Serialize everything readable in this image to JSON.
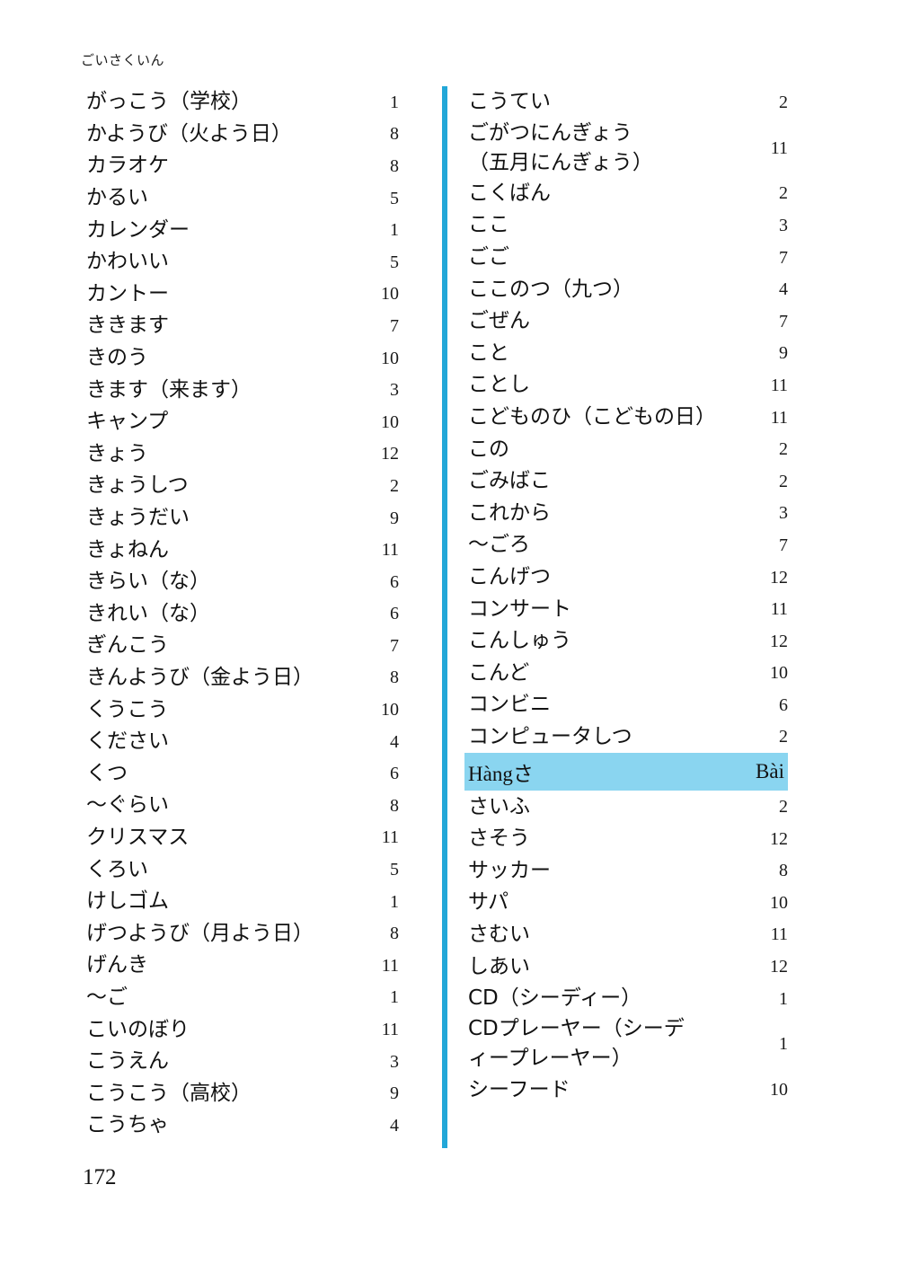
{
  "page": {
    "running_head": "ごいさくいん",
    "folio": "172",
    "accent_color": "#22a7d8",
    "highlight_color": "#8ad5f0"
  },
  "left_column": {
    "entries": [
      {
        "term": "がっこう（学校）",
        "lesson": "1"
      },
      {
        "term": "かようび（火よう日）",
        "lesson": "8"
      },
      {
        "term": "カラオケ",
        "lesson": "8"
      },
      {
        "term": "かるい",
        "lesson": "5"
      },
      {
        "term": "カレンダー",
        "lesson": "1"
      },
      {
        "term": "かわいい",
        "lesson": "5"
      },
      {
        "term": "カントー",
        "lesson": "10"
      },
      {
        "term": "ききます",
        "lesson": "7"
      },
      {
        "term": "きのう",
        "lesson": "10"
      },
      {
        "term": "きます（来ます）",
        "lesson": "3"
      },
      {
        "term": "キャンプ",
        "lesson": "10"
      },
      {
        "term": "きょう",
        "lesson": "12"
      },
      {
        "term": "きょうしつ",
        "lesson": "2"
      },
      {
        "term": "きょうだい",
        "lesson": "9"
      },
      {
        "term": "きょねん",
        "lesson": "11"
      },
      {
        "term": "きらい（な）",
        "lesson": "6"
      },
      {
        "term": "きれい（な）",
        "lesson": "6"
      },
      {
        "term": "ぎんこう",
        "lesson": "7"
      },
      {
        "term": "きんようび（金よう日）",
        "lesson": "8"
      },
      {
        "term": "くうこう",
        "lesson": "10"
      },
      {
        "term": "ください",
        "lesson": "4"
      },
      {
        "term": "くつ",
        "lesson": "6"
      },
      {
        "term": "〜ぐらい",
        "lesson": "8"
      },
      {
        "term": "クリスマス",
        "lesson": "11"
      },
      {
        "term": "くろい",
        "lesson": "5"
      },
      {
        "term": "けしゴム",
        "lesson": "1"
      },
      {
        "term": "げつようび（月よう日）",
        "lesson": "8"
      },
      {
        "term": "げんき",
        "lesson": "11"
      },
      {
        "term": "〜ご",
        "lesson": "1"
      },
      {
        "term": "こいのぼり",
        "lesson": "11"
      },
      {
        "term": "こうえん",
        "lesson": "3"
      },
      {
        "term": "こうこう（高校）",
        "lesson": "9"
      },
      {
        "term": "こうちゃ",
        "lesson": "4"
      }
    ]
  },
  "right_column": {
    "entries_before_section": [
      {
        "term": "こうてい",
        "lesson": "2",
        "tall": false
      },
      {
        "term": "ごがつにんぎょう\n（五月にんぎょう）",
        "lesson": "11",
        "tall": true
      },
      {
        "term": "こくばん",
        "lesson": "2",
        "tall": false
      },
      {
        "term": "ここ",
        "lesson": "3",
        "tall": false
      },
      {
        "term": "ごご",
        "lesson": "7",
        "tall": false
      },
      {
        "term": "ここのつ（九つ）",
        "lesson": "4",
        "tall": false
      },
      {
        "term": "ごぜん",
        "lesson": "7",
        "tall": false
      },
      {
        "term": "こと",
        "lesson": "9",
        "tall": false
      },
      {
        "term": "ことし",
        "lesson": "11",
        "tall": false
      },
      {
        "term": "こどものひ（こどもの日）",
        "lesson": "11",
        "tall": false
      },
      {
        "term": "この",
        "lesson": "2",
        "tall": false
      },
      {
        "term": "ごみばこ",
        "lesson": "2",
        "tall": false
      },
      {
        "term": "これから",
        "lesson": "3",
        "tall": false
      },
      {
        "term": "〜ごろ",
        "lesson": "7",
        "tall": false
      },
      {
        "term": "こんげつ",
        "lesson": "12",
        "tall": false
      },
      {
        "term": "コンサート",
        "lesson": "11",
        "tall": false
      },
      {
        "term": "こんしゅう",
        "lesson": "12",
        "tall": false
      },
      {
        "term": "こんど",
        "lesson": "10",
        "tall": false
      },
      {
        "term": "コンビニ",
        "lesson": "6",
        "tall": false
      },
      {
        "term": "コンピュータしつ",
        "lesson": "2",
        "tall": false
      }
    ],
    "section_header": {
      "label_prefix": "Hàng",
      "label_kana": "さ",
      "right_label": "Bài"
    },
    "entries_after_section": [
      {
        "term": "さいふ",
        "lesson": "2",
        "tall": false
      },
      {
        "term": "さそう",
        "lesson": "12",
        "tall": false
      },
      {
        "term": "サッカー",
        "lesson": "8",
        "tall": false
      },
      {
        "term": "サパ",
        "lesson": "10",
        "tall": false
      },
      {
        "term": "さむい",
        "lesson": "11",
        "tall": false
      },
      {
        "term": "しあい",
        "lesson": "12",
        "tall": false
      },
      {
        "term": "CD（シーディー）",
        "lesson": "1",
        "tall": false
      },
      {
        "term": "CDプレーヤー（シーデ\nィープレーヤー）",
        "lesson": "1",
        "tall": true
      },
      {
        "term": "シーフード",
        "lesson": "10",
        "tall": false
      }
    ]
  }
}
